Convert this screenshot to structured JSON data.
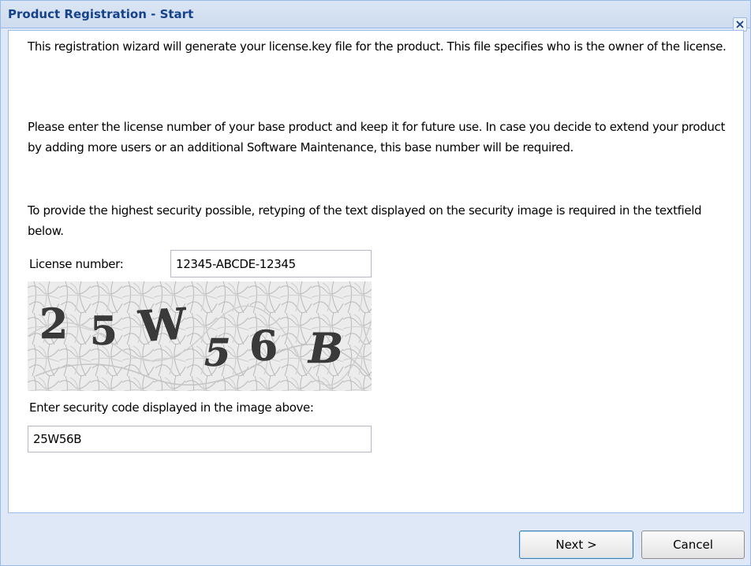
{
  "dialog": {
    "title": "Product Registration - Start",
    "close_icon": "close-icon"
  },
  "intro": {
    "paragraph1": "This registration wizard will generate your license.key file for the product. This file specifies who is the owner of the license.",
    "paragraph2": "Please enter the license number of your base product and keep it for future use. In case you decide to extend your product by adding more users or an additional Software Maintenance, this base number will be required.",
    "paragraph3": "To provide the highest security possible, retyping of the text displayed on the security image is required in the textfield below."
  },
  "form": {
    "license_label": "License number:",
    "license_value": "12345-ABCDE-12345",
    "captcha_text": "25W56B",
    "security_label": "Enter security code displayed in the image above:",
    "security_value": "25W56B"
  },
  "buttons": {
    "next_label": "Next >",
    "cancel_label": "Cancel"
  },
  "colors": {
    "title_text": "#15428b",
    "border": "#99bbe8",
    "dialog_background": "#dfe8f6"
  }
}
